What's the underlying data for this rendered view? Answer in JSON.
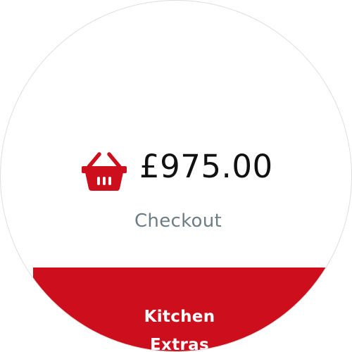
{
  "cart": {
    "icon": "basket-icon",
    "total": "£975.00",
    "checkout_label": "Checkout"
  },
  "menu": {
    "items": [
      {
        "label": "Kitchen Extras"
      }
    ]
  },
  "colors": {
    "accent": "#cd0e1d",
    "checkout_text": "#6d7d84",
    "total_text": "#111111"
  }
}
